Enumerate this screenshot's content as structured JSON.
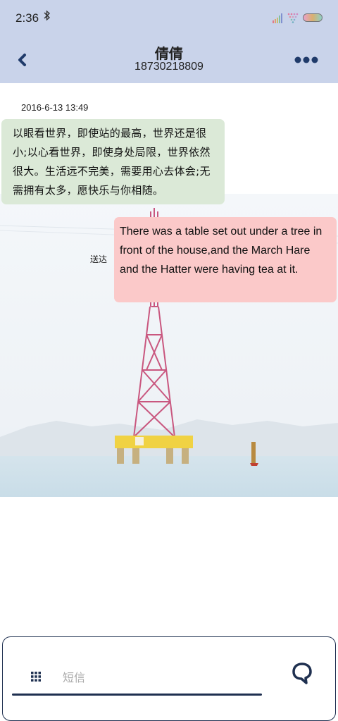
{
  "status_bar": {
    "time": "2:36",
    "icons": [
      "bluetooth-icon",
      "signal-icon",
      "wifi-icon",
      "battery-icon"
    ]
  },
  "header": {
    "contact_name": "倩倩",
    "phone_number": "18730218809",
    "back_icon": "chevron-left-icon",
    "more_icon": "more-dots-icon",
    "background_color": "#c9d3ea"
  },
  "conversation": {
    "timestamp": "2016-6-13 13:49",
    "messages": [
      {
        "direction": "incoming",
        "text": "以眼看世界，即使站的最高，世界还是很小;以心看世界，即使身处局限，世界依然很大。生活远不完美，需要用心去体会;无需拥有太多，愿快乐与你相随。",
        "bubble_color": "#dbe9d7"
      },
      {
        "direction": "outgoing",
        "status": "送达",
        "text": "There was a table set out under a tree in front of the house,and the March Hare and the Hatter were having tea at it.",
        "bubble_color": "#fbc9c9"
      }
    ]
  },
  "composer": {
    "placeholder": "短信",
    "value": "",
    "apps_icon": "grid-icon",
    "send_icon": "chat-bubble-send-icon",
    "accent_color": "#1f3050"
  }
}
